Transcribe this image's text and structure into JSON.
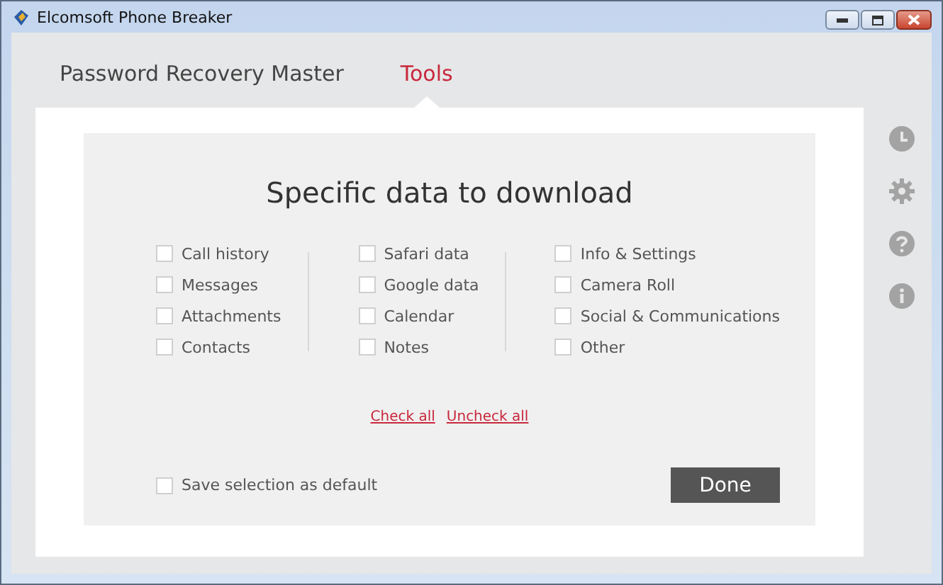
{
  "window": {
    "title": "Elcomsoft Phone Breaker"
  },
  "tabs": [
    {
      "label": "Password Recovery Master",
      "selected": false
    },
    {
      "label": "Tools",
      "selected": true
    }
  ],
  "dialog": {
    "heading": "Specific data to download",
    "columns": [
      [
        {
          "label": "Call history",
          "checked": false
        },
        {
          "label": "Messages",
          "checked": false
        },
        {
          "label": "Attachments",
          "checked": false
        },
        {
          "label": "Contacts",
          "checked": false
        }
      ],
      [
        {
          "label": "Safari data",
          "checked": false
        },
        {
          "label": "Google data",
          "checked": false
        },
        {
          "label": "Calendar",
          "checked": false
        },
        {
          "label": "Notes",
          "checked": false
        }
      ],
      [
        {
          "label": "Info & Settings",
          "checked": false
        },
        {
          "label": "Camera Roll",
          "checked": false
        },
        {
          "label": "Social & Communications",
          "checked": false
        },
        {
          "label": "Other",
          "checked": false
        }
      ]
    ],
    "links": [
      "Check all",
      "Uncheck all"
    ],
    "save_default": {
      "label": "Save selection as default",
      "checked": false
    },
    "done_button": "Done"
  }
}
